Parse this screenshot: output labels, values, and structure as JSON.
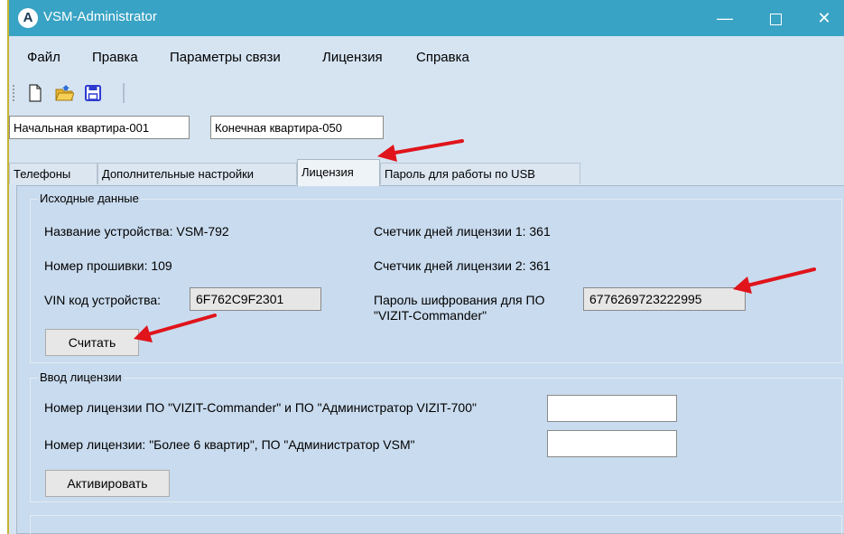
{
  "window": {
    "title": "VSM-Administrator",
    "icon": "app-logo-icon"
  },
  "menu": {
    "items": [
      "Файл",
      "Правка",
      "Параметры связи",
      "Лицензия",
      "Справка"
    ]
  },
  "toolbar": {
    "icons": [
      "new-file-icon",
      "open-folder-icon",
      "save-icon"
    ]
  },
  "apartments": {
    "start": "Начальная квартира-001",
    "end": "Конечная квартира-050"
  },
  "tabs": [
    {
      "label": "Телефоны"
    },
    {
      "label": "Дополнительные настройки"
    },
    {
      "label": "Лицензия",
      "active": true
    },
    {
      "label": "Пароль для работы по USB"
    }
  ],
  "source_data": {
    "group_title": "Исходные данные",
    "device_name": "Название устройства: VSM-792",
    "firmware": "Номер прошивки: 109",
    "vin_label": "VIN код устройства:",
    "vin_value": "6F762C9F2301",
    "counter1": "Счетчик дней лицензии 1: 361",
    "counter2": "Счетчик дней лицензии 2: 361",
    "password_label_line1": "Пароль шифрования для ПО",
    "password_label_line2": "\"VIZIT-Commander\"",
    "password_value": "6776269723222995",
    "read_button": "Считать"
  },
  "license_input": {
    "group_title": "Ввод лицензии",
    "license1_label": "Номер лицензии ПО \"VIZIT-Commander\" и ПО \"Администратор VIZIT-700\"",
    "license1_value": "",
    "license2_label": "Номер лицензии: \"Более 6 квартир\", ПО \"Администратор VSM\"",
    "license2_value": "",
    "activate_button": "Активировать"
  },
  "colors": {
    "titlebar": "#38a3c4",
    "window_bg": "#d6e4f2",
    "panel_bg": "#c9dbee",
    "annotation_arrow": "#e0141b"
  }
}
